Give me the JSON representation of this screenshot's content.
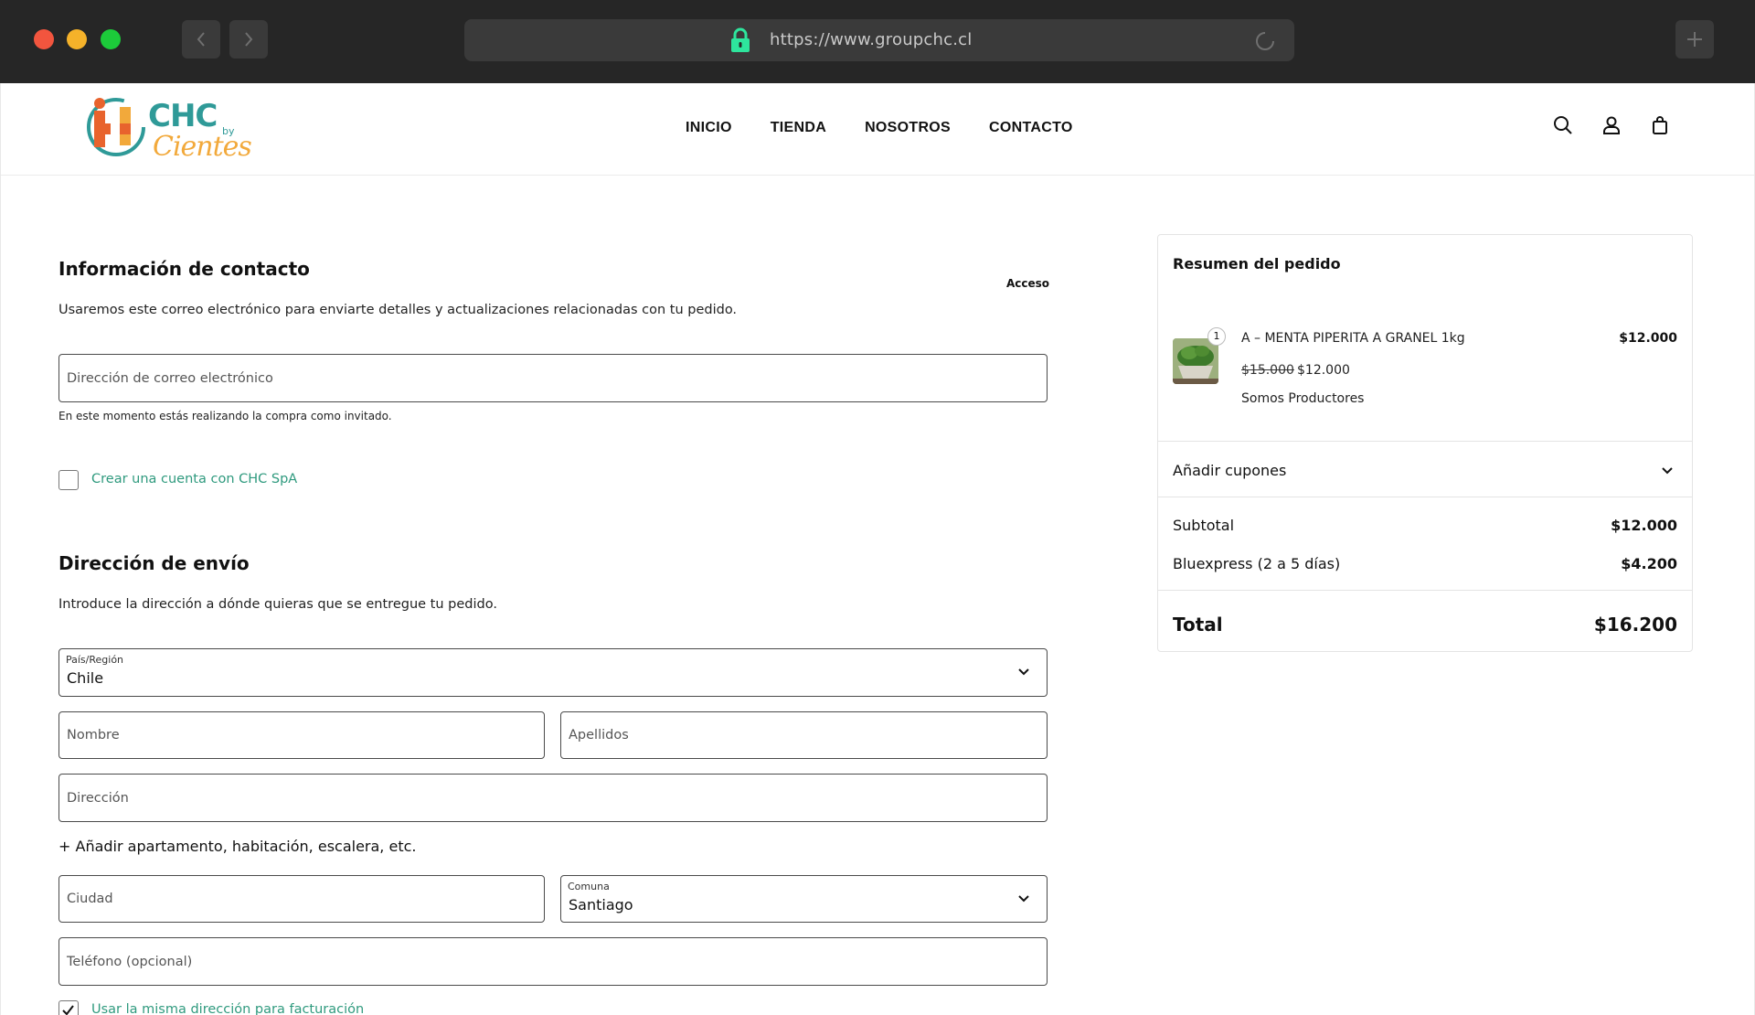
{
  "browser": {
    "url": "https://www.groupchc.cl",
    "colors": {
      "chrome_bg": "#262626",
      "close": "#f2553e",
      "minimize": "#f5b22a",
      "maximize": "#1ccb3a",
      "lock": "#2ee59d"
    },
    "icons": [
      "chevron-left-icon",
      "chevron-right-icon",
      "lock-icon",
      "reload-icon",
      "plus-icon"
    ]
  },
  "header": {
    "logo": {
      "brand": "CHC",
      "by": "by",
      "sub": "Cientes"
    },
    "nav": [
      "INICIO",
      "TIENDA",
      "NOSOTROS",
      "CONTACTO"
    ],
    "icons": [
      "search-icon",
      "account-icon",
      "cart-icon"
    ]
  },
  "contact": {
    "title": "Información de contacto",
    "login_link": "Acceso",
    "description": "Usaremos este correo electrónico para enviarte detalles y actualizaciones relacionadas con tu pedido.",
    "email_placeholder": "Dirección de correo electrónico",
    "guest_note": "En este momento estás realizando la compra como invitado.",
    "create_account_label": "Crear una cuenta con CHC SpA",
    "create_account_checked": false
  },
  "shipping": {
    "title": "Dirección de envío",
    "description": "Introduce la dirección a dónde quieras que se entregue tu pedido.",
    "country_label": "País/Región",
    "country_value": "Chile",
    "first_name_placeholder": "Nombre",
    "last_name_placeholder": "Apellidos",
    "address_placeholder": "Dirección",
    "add_apartment": "+ Añadir apartamento, habitación, escalera, etc.",
    "city_placeholder": "Ciudad",
    "comuna_label": "Comuna",
    "comuna_value": "Santiago",
    "phone_placeholder": "Teléfono (opcional)",
    "same_billing_label": "Usar la misma dirección para facturación",
    "same_billing_checked": true
  },
  "summary": {
    "title": "Resumen del pedido",
    "item": {
      "quantity": "1",
      "name": "A – MENTA PIPERITA A GRANEL 1kg",
      "line_price": "$12.000",
      "old_price": "$15.000",
      "new_price": "$12.000",
      "vendor": "Somos Productores"
    },
    "coupons_label": "Añadir cupones",
    "subtotal_label": "Subtotal",
    "subtotal_value": "$12.000",
    "shipping_label": "Bluexpress (2 a 5 días)",
    "shipping_value": "$4.200",
    "total_label": "Total",
    "total_value": "$16.200"
  },
  "colors": {
    "accent_green": "#2f9a7e",
    "logo_teal": "#2f9a98",
    "logo_orange": "#f2a93b"
  }
}
